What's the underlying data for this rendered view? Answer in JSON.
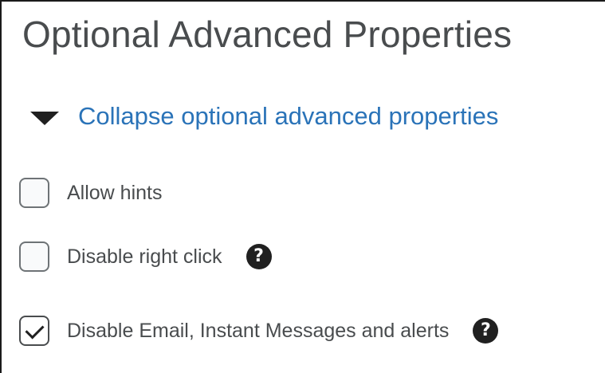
{
  "section": {
    "title": "Optional Advanced Properties",
    "collapse_label": "Collapse optional advanced properties"
  },
  "options": [
    {
      "label": "Allow hints",
      "checked": false,
      "has_help": false
    },
    {
      "label": "Disable right click",
      "checked": false,
      "has_help": true,
      "help_icon": "?"
    },
    {
      "label": "Disable Email, Instant Messages and alerts",
      "checked": true,
      "has_help": true,
      "help_icon": "?"
    }
  ],
  "colors": {
    "link": "#2a73b8",
    "text": "#494c4e",
    "icon": "#202020"
  },
  "icons": {
    "collapse": "caret-down-icon",
    "help": "help-circle-icon",
    "check": "checkmark-icon"
  }
}
